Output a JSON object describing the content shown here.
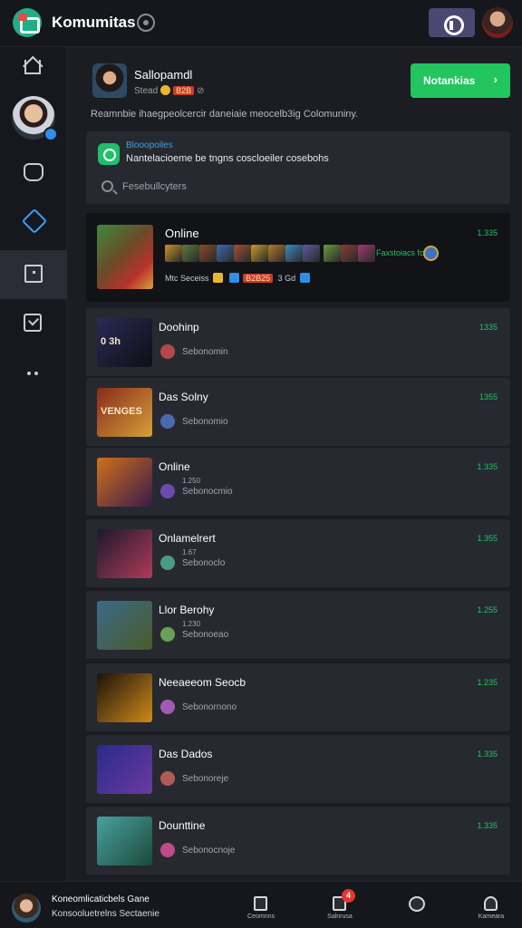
{
  "app": {
    "title": "Komumitas"
  },
  "profile": {
    "name": "Sallopamdl",
    "sub_text": "Stead",
    "rank": "B2B",
    "description": "Reamnbie ihaegpeolcercir daneiaie meocelb3ig Colomuniny.",
    "follow_label": "Notankias",
    "follow_arrow": "›"
  },
  "notice": {
    "title": "Blooopoiles",
    "text": "Nantelacioeme be tngns coscloeiler cosebohs"
  },
  "search": {
    "placeholder": "Fesebullcyters"
  },
  "featured": {
    "title": "Online",
    "count": "1.335",
    "mini_text": "Faxstoiacs fce",
    "tags_text_1": "Mtc  Seceiss",
    "tags_badge": "B2B25",
    "tags_text_2": "3  Gd"
  },
  "groups": [
    {
      "name": "Doohinp",
      "small": "",
      "sub": "Sebonomin",
      "count": "1335",
      "thumb_text": "0 3h",
      "color_a": "#2a2a55",
      "color_b": "#0e0f14",
      "avatar": "#b04a4a"
    },
    {
      "name": "Das Solny",
      "small": "",
      "sub": "Sebonomio",
      "count": "1355",
      "thumb_text": "VENGES",
      "color_a": "#8a2a1a",
      "color_b": "#d4a03a",
      "avatar": "#4a6ab0"
    },
    {
      "name": "Online",
      "small": "1.250",
      "sub": "Sebonocmio",
      "count": "1.335",
      "thumb_text": "",
      "color_a": "#d0701a",
      "color_b": "#3a1a4a",
      "avatar": "#6a4ab0"
    },
    {
      "name": "Onlamelrert",
      "small": "1.67",
      "sub": "Sebonoclo",
      "count": "1.355",
      "thumb_text": "",
      "color_a": "#1a1a2a",
      "color_b": "#b03a5a",
      "avatar": "#4a9a8a"
    },
    {
      "name": "Llor Berohy",
      "small": "1.230",
      "sub": "Sebonoeao",
      "count": "1.255",
      "thumb_text": "",
      "color_a": "#3a6a8a",
      "color_b": "#4a5a2a",
      "avatar": "#6aa05a"
    },
    {
      "name": "Neeaeeom Seocb",
      "small": "",
      "sub": "Sebonornono",
      "count": "1.235",
      "thumb_text": "",
      "color_a": "#1a120a",
      "color_b": "#d08a1a",
      "avatar": "#a05ab0"
    },
    {
      "name": "Das Dados",
      "small": "",
      "sub": "Sebonoreje",
      "count": "1.335",
      "thumb_text": "",
      "color_a": "#2a2a8a",
      "color_b": "#6a3aa0",
      "avatar": "#b05a5a"
    },
    {
      "name": "Dounttine",
      "small": "",
      "sub": "Sebonocnoje",
      "count": "1.335",
      "thumb_text": "",
      "color_a": "#4aa0a0",
      "color_b": "#1a4a3a",
      "avatar": "#c04a8a"
    }
  ],
  "footer": {
    "line1": "Koneomlicaticbels Gane",
    "line2": "Konsooluetrelns Sectaenie",
    "nav": [
      {
        "label": "Ceomnns",
        "badge": ""
      },
      {
        "label": "Salnrusa",
        "badge": "4"
      },
      {
        "label": "",
        "badge": ""
      },
      {
        "label": "Kameara",
        "badge": ""
      }
    ]
  },
  "colors": {
    "accent": "#22c55e",
    "link": "#3aa0e8",
    "background": "#1b1d23"
  },
  "icons": [
    "app-logo-icon",
    "settings-icon",
    "voice-icon",
    "home-icon",
    "people-icon",
    "compass-icon",
    "square-icon",
    "inbox-icon",
    "more-icon",
    "search-icon",
    "chat-icon"
  ]
}
